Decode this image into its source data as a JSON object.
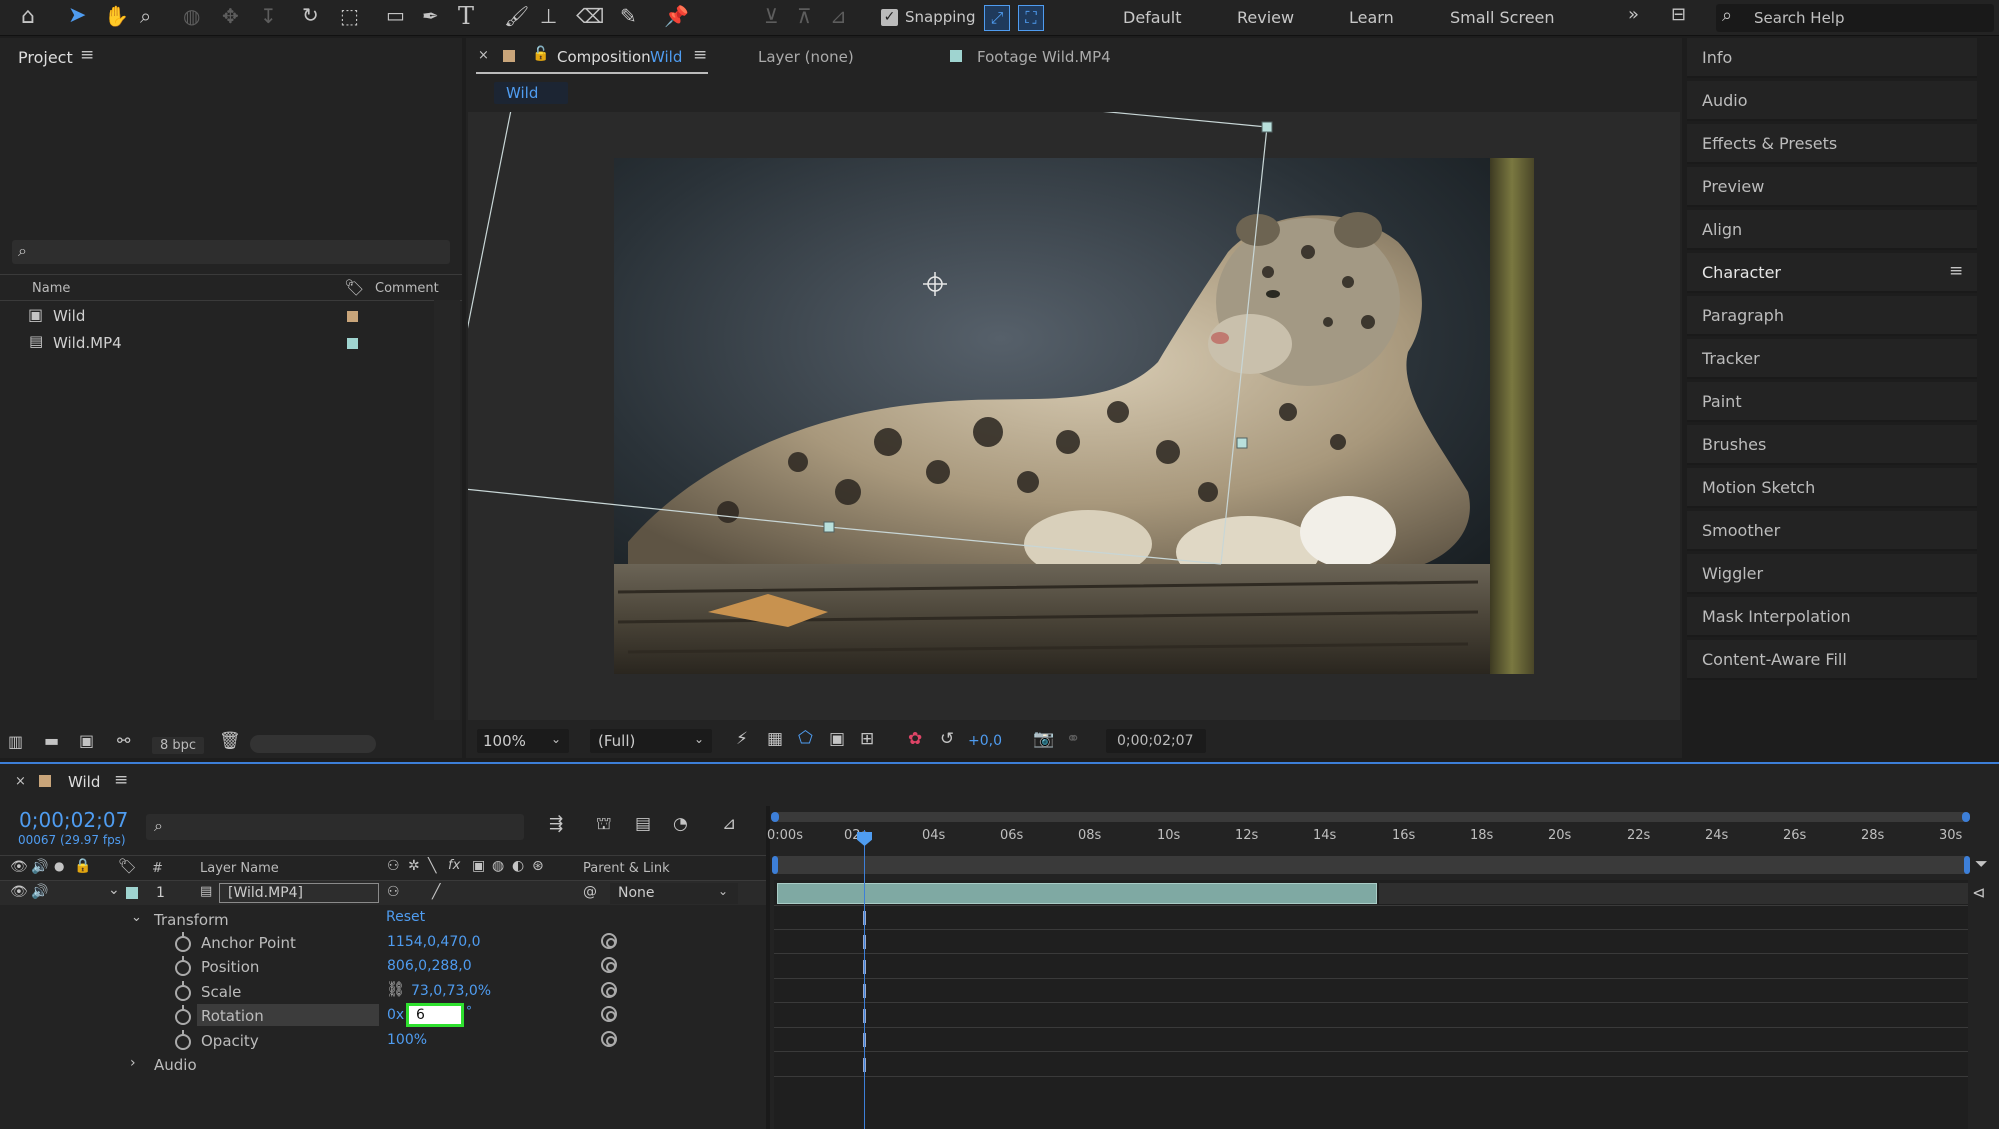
{
  "toolbar": {
    "snapping_label": "Snapping",
    "workspaces": [
      "Default",
      "Review",
      "Learn",
      "Small Screen"
    ],
    "search_placeholder": "Search Help"
  },
  "project": {
    "title": "Project",
    "columns": {
      "name": "Name",
      "comment": "Comment"
    },
    "items": [
      {
        "name": "Wild",
        "label_color": "#c9a57a"
      },
      {
        "name": "Wild.MP4",
        "label_color": "#9fd4d0"
      }
    ],
    "bpc": "8 bpc"
  },
  "viewer": {
    "tab_prefix": "Composition",
    "tab_name": "Wild",
    "layer_tab": "Layer (none)",
    "footage_tab": "Footage Wild.MP4",
    "breadcrumb": "Wild",
    "zoom": "100%",
    "resolution": "(Full)",
    "exposure": "+0,0",
    "timecode": "0;00;02;07"
  },
  "right_panels": [
    "Info",
    "Audio",
    "Effects & Presets",
    "Preview",
    "Align",
    "Character",
    "Paragraph",
    "Tracker",
    "Paint",
    "Brushes",
    "Motion Sketch",
    "Smoother",
    "Wiggler",
    "Mask Interpolation",
    "Content-Aware Fill"
  ],
  "timeline": {
    "comp_name": "Wild",
    "timecode": "0;00;02;07",
    "frames": "00067 (29.97 fps)",
    "col_hash": "#",
    "col_layer_name": "Layer Name",
    "col_parent": "Parent & Link",
    "layer": {
      "index": "1",
      "name": "[Wild.MP4]",
      "parent": "None"
    },
    "transform_label": "Transform",
    "reset_label": "Reset",
    "properties": {
      "anchor_label": "Anchor Point",
      "anchor_value": "1154,0,470,0",
      "position_label": "Position",
      "position_value": "806,0,288,0",
      "scale_label": "Scale",
      "scale_value": "73,0,73,0%",
      "rotation_label": "Rotation",
      "rotation_prefix": "0x",
      "rotation_value": "6",
      "rotation_suffix": "°",
      "opacity_label": "Opacity",
      "opacity_value": "100%"
    },
    "audio_label": "Audio",
    "ruler": [
      "0:00s",
      "02s",
      "04s",
      "06s",
      "08s",
      "10s",
      "12s",
      "14s",
      "16s",
      "18s",
      "20s",
      "22s",
      "24s",
      "26s",
      "28s",
      "30s"
    ]
  }
}
